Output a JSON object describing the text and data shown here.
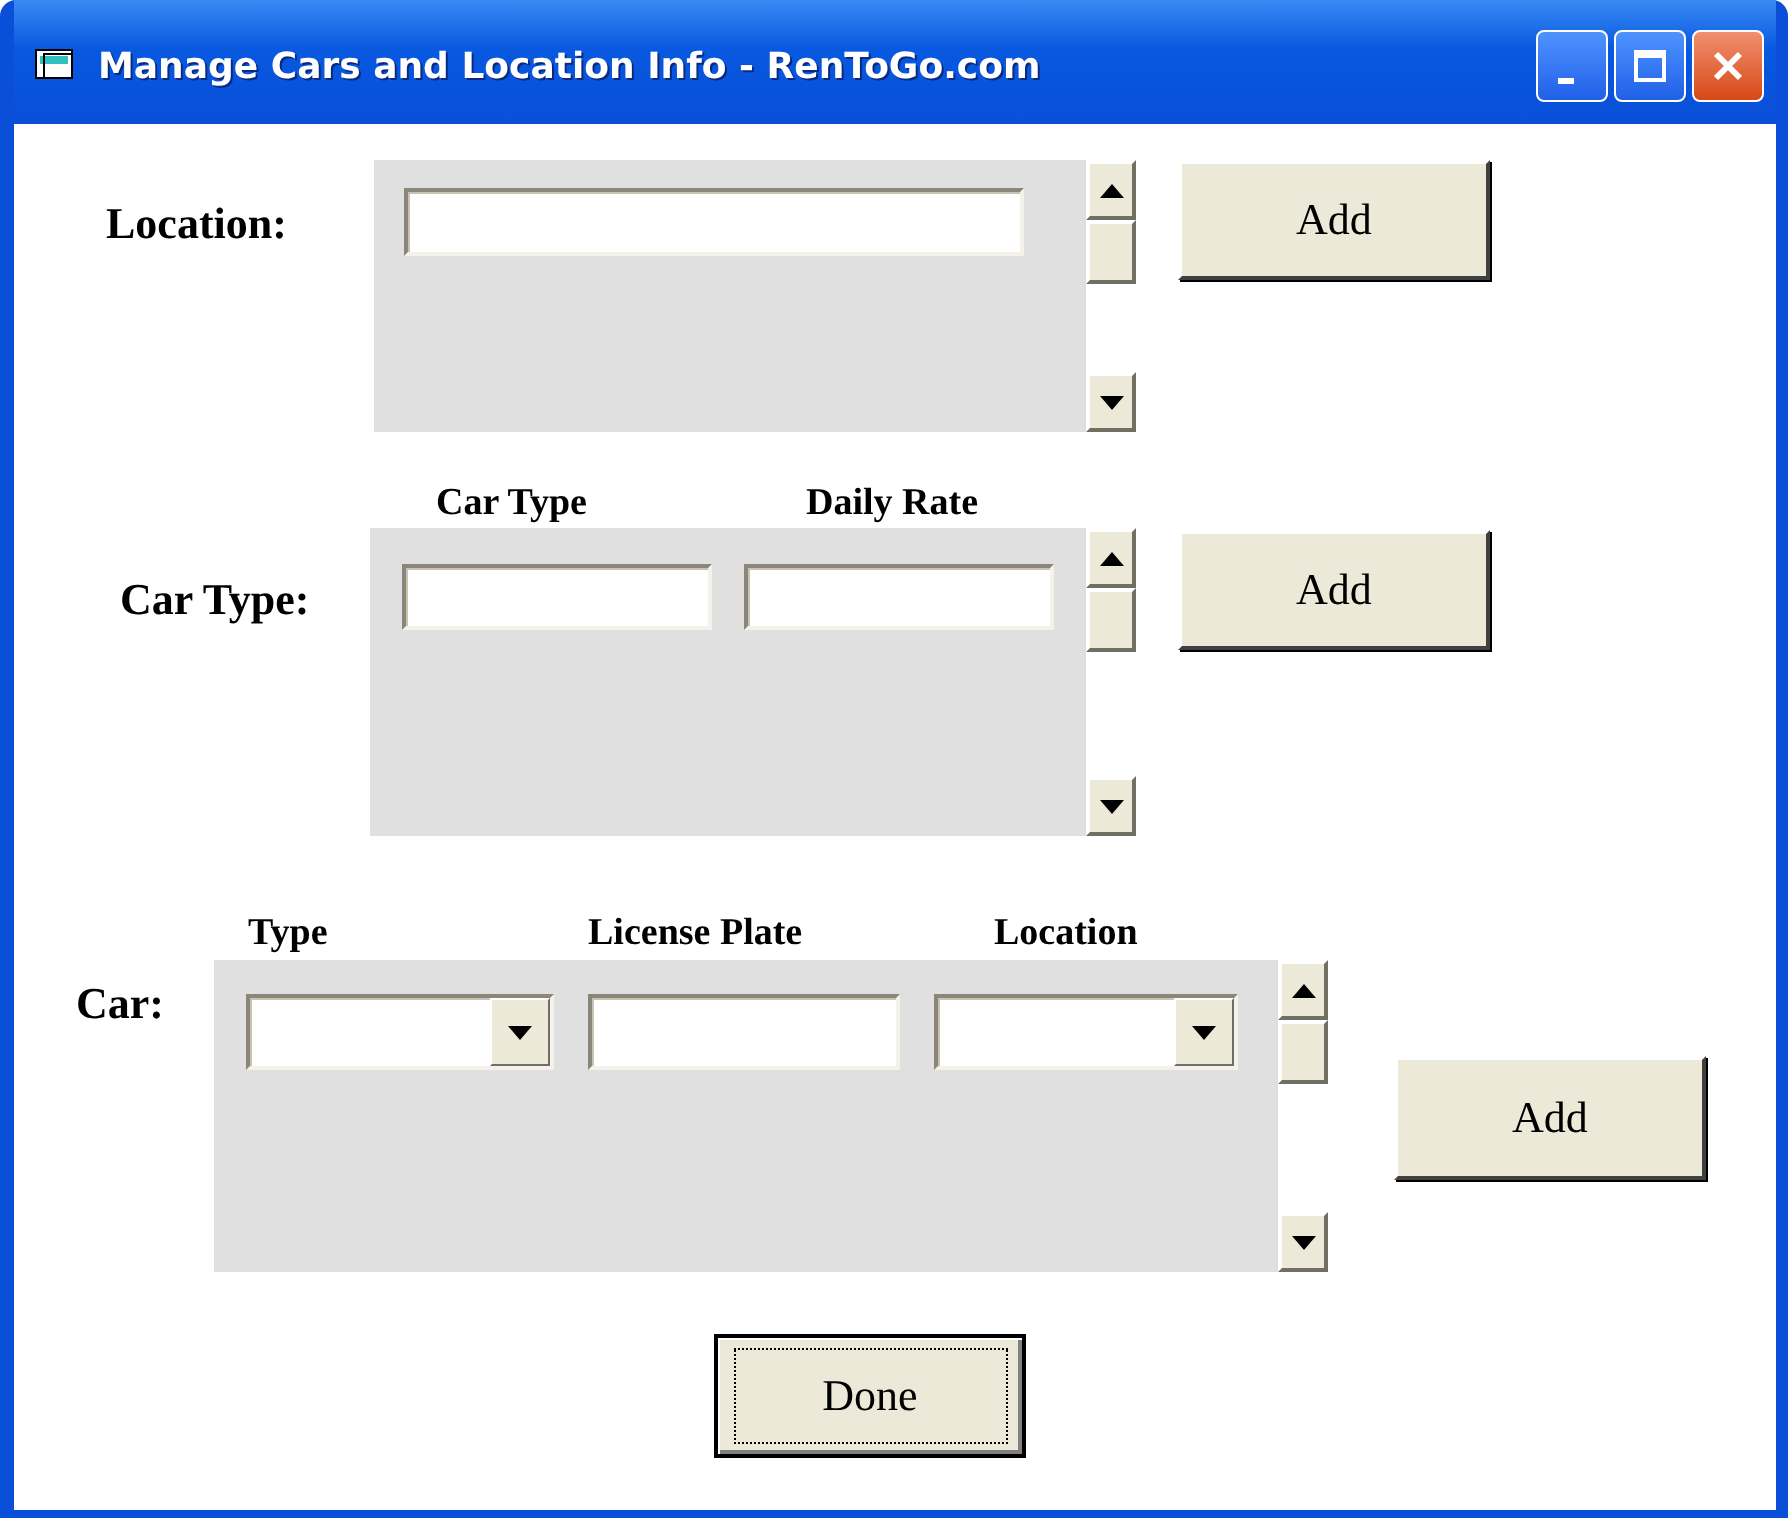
{
  "window": {
    "title": "Manage Cars and Location Info - RenToGo.com"
  },
  "sections": [
    {
      "label": "Location:",
      "columns": [
        {
          "kind": "text"
        }
      ],
      "button": "Add"
    },
    {
      "label": "Car Type:",
      "columns": [
        {
          "heading": "Car Type",
          "kind": "text"
        },
        {
          "heading": "Daily Rate",
          "kind": "text"
        }
      ],
      "button": "Add"
    },
    {
      "label": "Car:",
      "columns": [
        {
          "heading": "Type",
          "kind": "dropdown"
        },
        {
          "heading": "License Plate",
          "kind": "text"
        },
        {
          "heading": "Location",
          "kind": "dropdown"
        }
      ],
      "button": "Add"
    }
  ],
  "done_button": {
    "label": "Done",
    "focused": true
  }
}
